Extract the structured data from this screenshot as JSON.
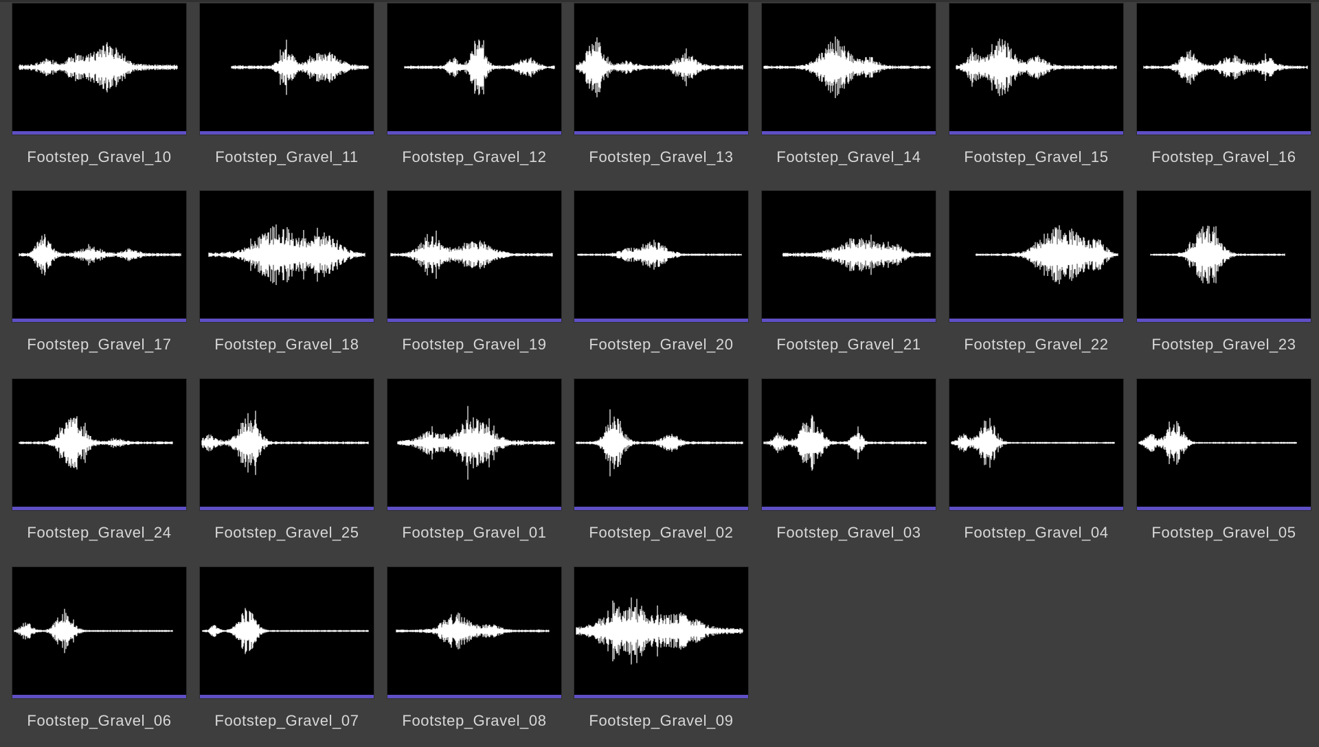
{
  "colors": {
    "background": "#3e3e3e",
    "thumbnail": "#000000",
    "waveform": "#ffffff",
    "asset_type_bar": "#5e4fc4",
    "label": "#d8d8d8"
  },
  "asset_icon": "sound-wave-icon",
  "assets": [
    {
      "name": "Footstep_Gravel_10"
    },
    {
      "name": "Footstep_Gravel_11"
    },
    {
      "name": "Footstep_Gravel_12"
    },
    {
      "name": "Footstep_Gravel_13"
    },
    {
      "name": "Footstep_Gravel_14"
    },
    {
      "name": "Footstep_Gravel_15"
    },
    {
      "name": "Footstep_Gravel_16"
    },
    {
      "name": "Footstep_Gravel_17"
    },
    {
      "name": "Footstep_Gravel_18"
    },
    {
      "name": "Footstep_Gravel_19"
    },
    {
      "name": "Footstep_Gravel_20"
    },
    {
      "name": "Footstep_Gravel_21"
    },
    {
      "name": "Footstep_Gravel_22"
    },
    {
      "name": "Footstep_Gravel_23"
    },
    {
      "name": "Footstep_Gravel_24"
    },
    {
      "name": "Footstep_Gravel_25"
    },
    {
      "name": "Footstep_Gravel_01"
    },
    {
      "name": "Footstep_Gravel_02"
    },
    {
      "name": "Footstep_Gravel_03"
    },
    {
      "name": "Footstep_Gravel_04"
    },
    {
      "name": "Footstep_Gravel_05"
    },
    {
      "name": "Footstep_Gravel_06"
    },
    {
      "name": "Footstep_Gravel_07"
    },
    {
      "name": "Footstep_Gravel_08"
    },
    {
      "name": "Footstep_Gravel_09"
    }
  ]
}
